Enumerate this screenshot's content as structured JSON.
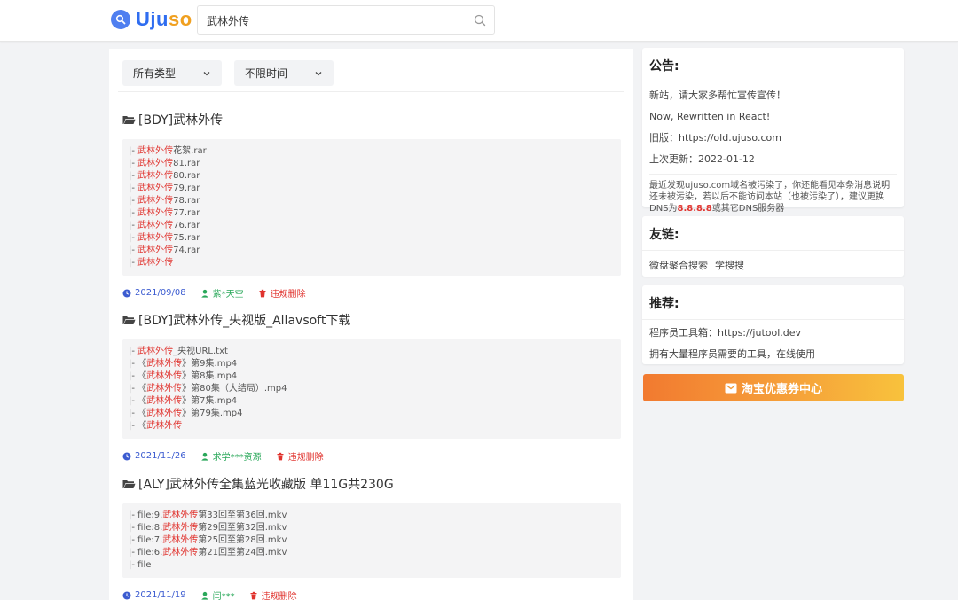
{
  "header": {
    "logo_text_u": "U",
    "logo_text_rest": "ju",
    "logo_text_so": "so",
    "search_value": "武林外传"
  },
  "filters": {
    "type_label": "所有类型",
    "time_label": "不限时间"
  },
  "results": [
    {
      "title": "[BDY]武林外传",
      "files": [
        {
          "prefix": "|- ",
          "hl": "武林外传",
          "rest": "花絮.rar"
        },
        {
          "prefix": "|- ",
          "hl": "武林外传",
          "rest": "81.rar"
        },
        {
          "prefix": "|- ",
          "hl": "武林外传",
          "rest": "80.rar"
        },
        {
          "prefix": "|- ",
          "hl": "武林外传",
          "rest": "79.rar"
        },
        {
          "prefix": "|- ",
          "hl": "武林外传",
          "rest": "78.rar"
        },
        {
          "prefix": "|- ",
          "hl": "武林外传",
          "rest": "77.rar"
        },
        {
          "prefix": "|- ",
          "hl": "武林外传",
          "rest": "76.rar"
        },
        {
          "prefix": "|- ",
          "hl": "武林外传",
          "rest": "75.rar"
        },
        {
          "prefix": "|- ",
          "hl": "武林外传",
          "rest": "74.rar"
        },
        {
          "prefix": "|- ",
          "hl": "武林外传",
          "rest": ""
        }
      ],
      "date": "2021/09/08",
      "user": "紫*天空",
      "report": "违规删除"
    },
    {
      "title": "[BDY]武林外传_央视版_Allavsoft下载",
      "files": [
        {
          "prefix": "|- ",
          "hl": "武林外传",
          "rest": "_央视URL.txt"
        },
        {
          "prefix": "|- 《",
          "hl": "武林外传",
          "rest": "》第9集.mp4"
        },
        {
          "prefix": "|- 《",
          "hl": "武林外传",
          "rest": "》第8集.mp4"
        },
        {
          "prefix": "|- 《",
          "hl": "武林外传",
          "rest": "》第80集（大结局）.mp4"
        },
        {
          "prefix": "|- 《",
          "hl": "武林外传",
          "rest": "》第7集.mp4"
        },
        {
          "prefix": "|- 《",
          "hl": "武林外传",
          "rest": "》第79集.mp4"
        },
        {
          "prefix": "|- 《",
          "hl": "武林外传",
          "rest": ""
        }
      ],
      "date": "2021/11/26",
      "user": "求学***资源",
      "report": "违规删除"
    },
    {
      "title": "[ALY]武林外传全集蓝光收藏版 单11G共230G",
      "files": [
        {
          "prefix": "|- file:9.",
          "hl": "武林外传",
          "rest": "第33回至第36回.mkv"
        },
        {
          "prefix": "|- file:8.",
          "hl": "武林外传",
          "rest": "第29回至第32回.mkv"
        },
        {
          "prefix": "|- file:7.",
          "hl": "武林外传",
          "rest": "第25回至第28回.mkv"
        },
        {
          "prefix": "|- file:6.",
          "hl": "武林外传",
          "rest": "第21回至第24回.mkv"
        },
        {
          "prefix": "|- file",
          "hl": "",
          "rest": ""
        }
      ],
      "date": "2021/11/19",
      "user": "闫***",
      "report": "违规删除"
    }
  ],
  "notice": {
    "title": "公告:",
    "lines": [
      "新站，请大家多帮忙宣传宣传！",
      "Now, Rewritten in React!",
      "旧版：https://old.ujuso.com",
      "上次更新：2022-01-12"
    ],
    "note_pre": "最近发现ujuso.com域名被污染了，你还能看见本条消息说明还未被污染，若以后不能访问本站（也被污染了），建议更换DNS为",
    "note_dns": "8.8.8.8",
    "note_post": "或其它DNS服务器"
  },
  "friends": {
    "title": "友链:",
    "links": [
      "微盘聚合搜索",
      "学搜搜"
    ]
  },
  "recommend": {
    "title": "推荐:",
    "lines": [
      "程序员工具箱：https://jutool.dev",
      "拥有大量程序员需要的工具，在线使用"
    ]
  },
  "taobao": {
    "label": "淘宝优惠券中心"
  },
  "colors": {
    "accent_blue": "#2f6df0",
    "logo_orange": "#f0a020",
    "highlight_red": "#e0332e",
    "user_green": "#2aa85a",
    "banner_start": "#f27a30",
    "banner_end": "#f8c23c"
  }
}
